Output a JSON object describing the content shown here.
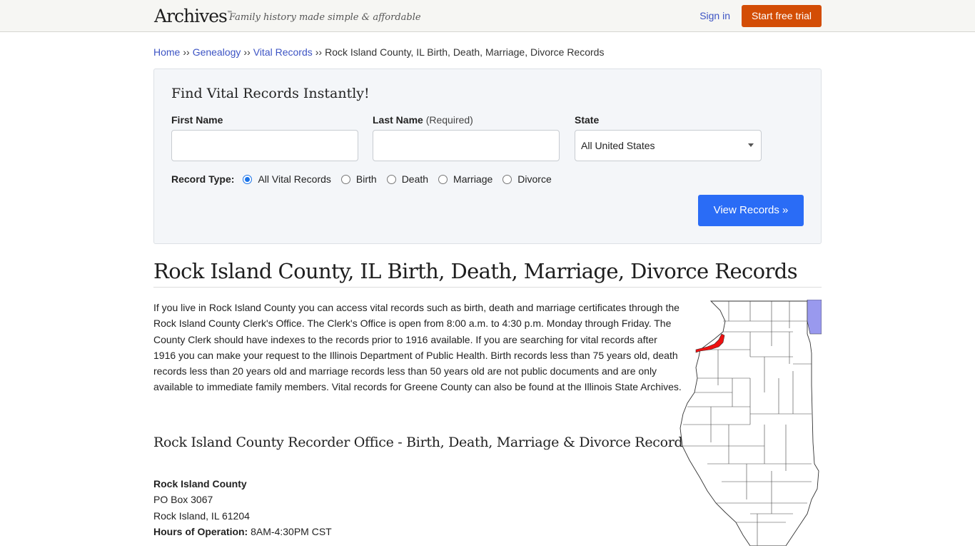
{
  "header": {
    "logo": "Archives",
    "logo_tm": "™",
    "tagline": "Family history made simple & affordable",
    "sign_in": "Sign in",
    "start_trial": "Start free trial"
  },
  "breadcrumb": {
    "items": [
      "Home",
      "Genealogy",
      "Vital Records"
    ],
    "separator": "››",
    "current": "Rock Island County, IL Birth, Death, Marriage, Divorce Records"
  },
  "search": {
    "title": "Find Vital Records Instantly!",
    "first_name_label": "First Name",
    "first_name_value": "",
    "last_name_label": "Last Name",
    "last_name_required": "(Required)",
    "last_name_value": "",
    "state_label": "State",
    "state_value": "All United States",
    "record_type_label": "Record Type:",
    "record_types": [
      {
        "label": "All Vital Records",
        "checked": true
      },
      {
        "label": "Birth",
        "checked": false
      },
      {
        "label": "Death",
        "checked": false
      },
      {
        "label": "Marriage",
        "checked": false
      },
      {
        "label": "Divorce",
        "checked": false
      }
    ],
    "submit": "View Records »"
  },
  "page": {
    "title": "Rock Island County, IL Birth, Death, Marriage, Divorce Records",
    "intro": "If you live in Rock Island County you can access vital records such as birth, death and marriage certificates through the Rock Island County Clerk's Office. The Clerk's Office is open from 8:00 a.m. to 4:30 p.m. Monday through Friday. The County Clerk should have indexes to the records prior to 1916 available. If you are searching for vital records after 1916 you can make your request to the Illinois Department of Public Health. Birth records less than 75 years old, death records less than 20 years old and marriage records less than 50 years old are not public documents and are only available to immediate family members. Vital records for Greene County can also be found at the Illinois State Archives.",
    "subtitle": "Rock Island County Recorder Office - Birth, Death, Marriage & Divorce Records",
    "map_alt": "Illinois county map highlighting Rock Island County",
    "map_colors": {
      "highlight": "#ee1111",
      "lake": "#9999ee",
      "outline": "#333333"
    }
  },
  "office": {
    "name": "Rock Island County",
    "address1": "PO Box 3067",
    "address2": "Rock Island, IL 61204",
    "hours_label": "Hours of Operation:",
    "hours": "8AM-4:30PM CST"
  }
}
